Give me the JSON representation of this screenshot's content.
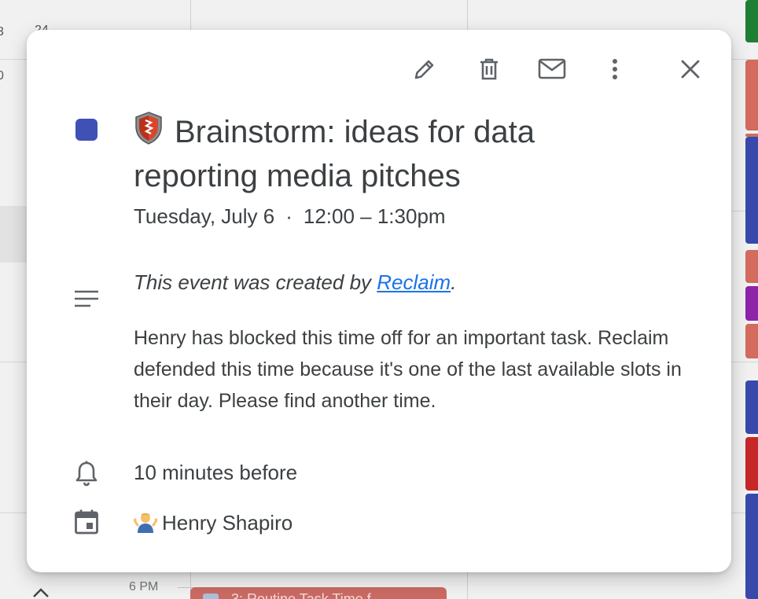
{
  "background": {
    "left_edge_labels": [
      "3",
      "24",
      "0"
    ],
    "time_label": "6 PM",
    "event_peek_title": "3: Routine Task Time f",
    "strip_colors": [
      "#1e7e34",
      "#d36b5e",
      "#c8705f",
      "#3949ab",
      "#d36b5e",
      "#8e24aa",
      "#d36b5e",
      "#3949ab",
      "#c62828",
      "#3949ab"
    ]
  },
  "toolbar": {
    "edit_icon": "pencil-icon",
    "delete_icon": "trash-icon",
    "email_icon": "mail-icon",
    "more_icon": "more-vert-icon",
    "close_icon": "close-icon"
  },
  "event": {
    "color": "#3f51b5",
    "title": "Brainstorm: ideas for data reporting media pitches",
    "date": "Tuesday, July 6",
    "separator": "·",
    "time": "12:00 – 1:30pm",
    "created_prefix": "This event was created by ",
    "created_link": "Reclaim",
    "created_suffix": ".",
    "description": "Henry has blocked this time off for an important task. Reclaim defended this time because it's one of the last available slots in their day. Please find another time.",
    "reminder": "10 minutes before",
    "calendar_owner": "Henry Shapiro"
  }
}
